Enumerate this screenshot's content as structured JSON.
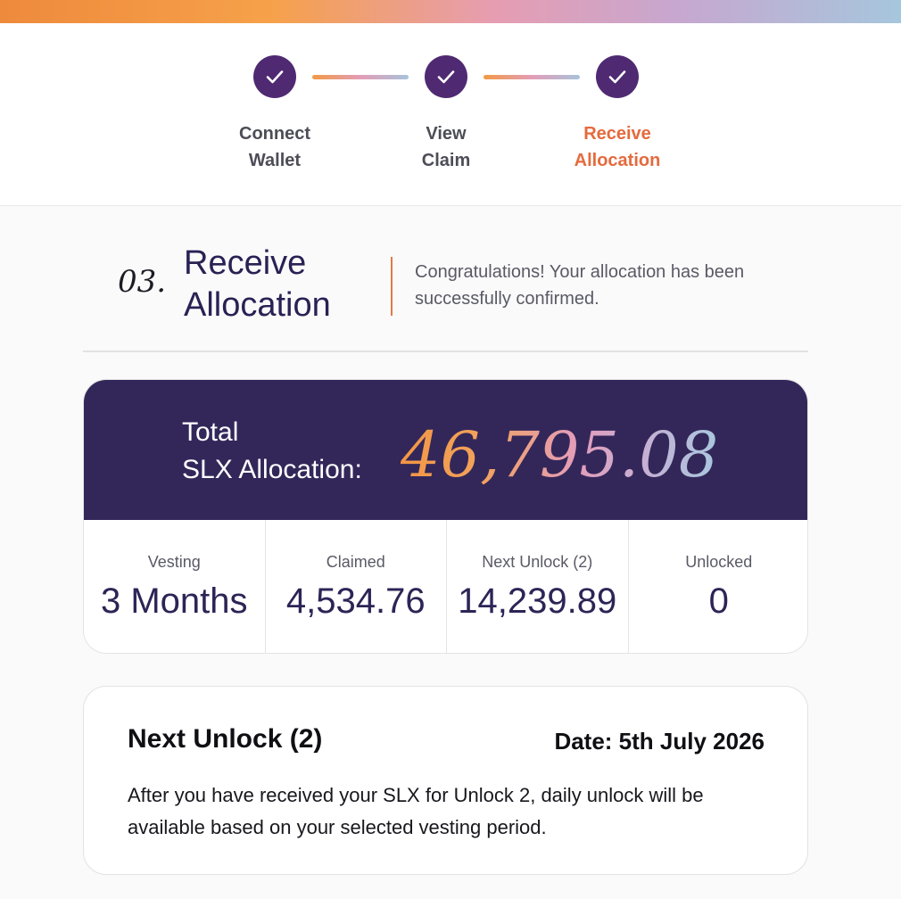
{
  "stepper": {
    "steps": [
      {
        "label_line1": "Connect",
        "label_line2": "Wallet",
        "state": "complete"
      },
      {
        "label_line1": "View",
        "label_line2": "Claim",
        "state": "complete"
      },
      {
        "label_line1": "Receive",
        "label_line2": "Allocation",
        "state": "complete-active"
      }
    ],
    "icon": "check-icon"
  },
  "section": {
    "number": "03.",
    "title": "Receive Allocation",
    "description": "Congratulations! Your allocation has been successfully confirmed."
  },
  "allocation": {
    "label_line1": "Total",
    "label_line2": "SLX Allocation:",
    "value": "46,795.08",
    "stats": [
      {
        "label": "Vesting",
        "value": "3 Months"
      },
      {
        "label": "Claimed",
        "value": "4,534.76"
      },
      {
        "label": "Next Unlock (2)",
        "value": "14,239.89"
      },
      {
        "label": "Unlocked",
        "value": "0"
      }
    ]
  },
  "next_unlock": {
    "title": "Next Unlock (2)",
    "date": "Date: 5th July 2026",
    "description": "After you have received your SLX for Unlock 2, daily unlock will be available based on your selected vesting period."
  },
  "colors": {
    "step_circle": "#4f2a72",
    "active_step": "#e56a3d",
    "card_header": "#33275a",
    "accent_line": "#e07a48"
  }
}
